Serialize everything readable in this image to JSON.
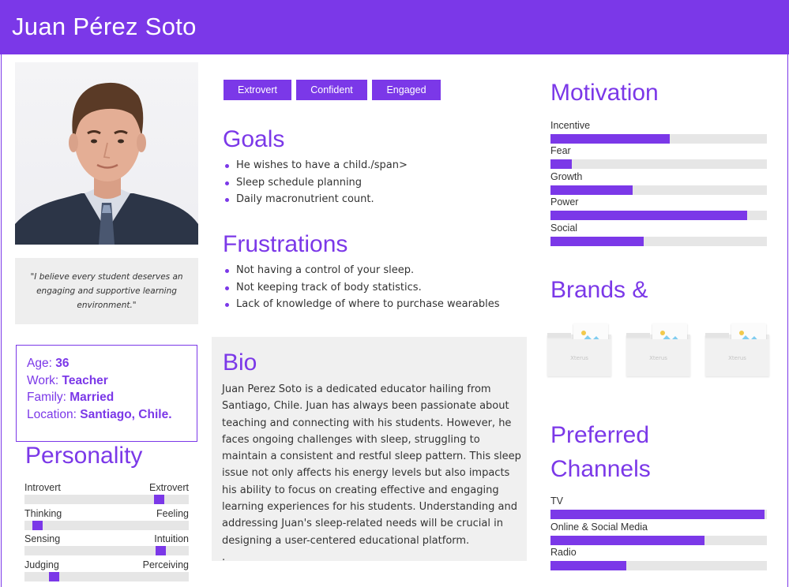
{
  "persona": {
    "name": "Juan Pérez Soto"
  },
  "quote": "\"I believe every student deserves an engaging and supportive learning environment.\"",
  "info": {
    "age_label": "Age:",
    "age": "36",
    "work_label": "Work:",
    "work": "Teacher",
    "family_label": "Family:",
    "family": "Married",
    "location_label": "Location:",
    "location": "Santiago, Chile."
  },
  "personality": {
    "title": "Personality",
    "traits": [
      {
        "left": "Introvert",
        "right": "Extrovert",
        "value": 0.84
      },
      {
        "left": "Thinking",
        "right": "Feeling",
        "value": 0.05
      },
      {
        "left": "Sensing",
        "right": "Intuition",
        "value": 0.85
      },
      {
        "left": "Judging",
        "right": "Perceiving",
        "value": 0.16
      }
    ]
  },
  "tags": [
    "Extrovert",
    "Confident",
    "Engaged"
  ],
  "goals": {
    "title": "Goals",
    "items": [
      "He wishes to have a child./span>",
      "Sleep schedule planning",
      "Daily macronutrient count."
    ]
  },
  "frustrations": {
    "title": "Frustrations",
    "items": [
      "Not having a control of your sleep.",
      "Not keeping track of body statistics.",
      "Lack of knowledge of where to purchase wearables"
    ]
  },
  "bio": {
    "title": "Bio",
    "text": "Juan Perez Soto is a dedicated educator hailing from Santiago, Chile. Juan has always been passionate about teaching and connecting with his students. However, he faces ongoing challenges with sleep, struggling to maintain a consistent and restful sleep pattern. This sleep issue not only affects his energy levels but also impacts his ability to focus on creating effective and engaging learning experiences for his students. Understanding and addressing Juan's sleep-related needs will be crucial in designing a user-centered educational platform.",
    "trailing": "."
  },
  "motivation": {
    "title": "Motivation",
    "items": [
      {
        "label": "Incentive",
        "value": 0.55
      },
      {
        "label": "Fear",
        "value": 0.1
      },
      {
        "label": "Growth",
        "value": 0.38
      },
      {
        "label": "Power",
        "value": 0.91
      },
      {
        "label": "Social",
        "value": 0.43
      }
    ]
  },
  "brands": {
    "title": "Brands &",
    "placeholder_text": "Xterus"
  },
  "channels": {
    "title_line1": "Preferred",
    "title_line2": "Channels",
    "items": [
      {
        "label": "TV",
        "value": 0.99
      },
      {
        "label": "Online & Social Media",
        "value": 0.71
      },
      {
        "label": "Radio",
        "value": 0.35
      }
    ]
  },
  "colors": {
    "accent": "#7b38e8",
    "track": "#e6e6e6",
    "panel": "#f0f0f0"
  },
  "icons": [
    "person-photo",
    "image-placeholder-icon"
  ]
}
